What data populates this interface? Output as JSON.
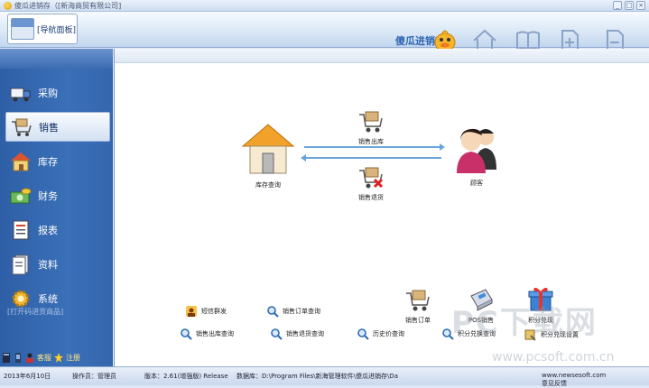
{
  "window": {
    "title": "傻瓜进销存（[新海商贸有限公司]",
    "buttons": [
      "_",
      "□",
      "×"
    ]
  },
  "toolbar": {
    "nav_tab_label": "[导航面板]",
    "brand": "傻瓜进销存"
  },
  "sidebar": {
    "items": [
      {
        "label": "采购",
        "icon": "truck-icon"
      },
      {
        "label": "销售",
        "icon": "shopping-cart-icon"
      },
      {
        "label": "库存",
        "icon": "house-icon"
      },
      {
        "label": "财务",
        "icon": "money-icon"
      },
      {
        "label": "报表",
        "icon": "report-icon"
      },
      {
        "label": "资料",
        "icon": "document-icon"
      },
      {
        "label": "系统",
        "icon": "gear-icon"
      }
    ],
    "hint": "[打开码进货商品]",
    "bottom": {
      "service_label": "客服",
      "register_label": "注册"
    }
  },
  "flow": {
    "stock_query": "库存查询",
    "sales_out": "销售出库",
    "sales_return": "销售退货",
    "customer": "顾客"
  },
  "quick_links": {
    "sms": "短信群发",
    "order_query": "销售订单查询",
    "out_query": "销售出库查询",
    "return_query": "销售退货查询",
    "history_query": "历史价查询",
    "points_query": "积分兑换查询",
    "sales_order": "销售订单",
    "pos": "POS销售",
    "points_exchange": "积分兑现",
    "points_setting": "积分兑现设置"
  },
  "status": {
    "date": "2013年6月10日",
    "operator": "操作员：管理员",
    "version": "版本：2.61(增强版) Release",
    "database": "数据库：D:\\Program Files\\新海管理软件\\傻瓜进销存\\Da",
    "website": "www.newsesoft.com",
    "feedback": "意见反馈"
  },
  "watermark": {
    "main": "PC下载网",
    "url": "www.pcsoft.com.cn"
  },
  "colors": {
    "sidebar": "#3566ad",
    "accent": "#2f67b4",
    "arrow": "#6aa4dc"
  }
}
